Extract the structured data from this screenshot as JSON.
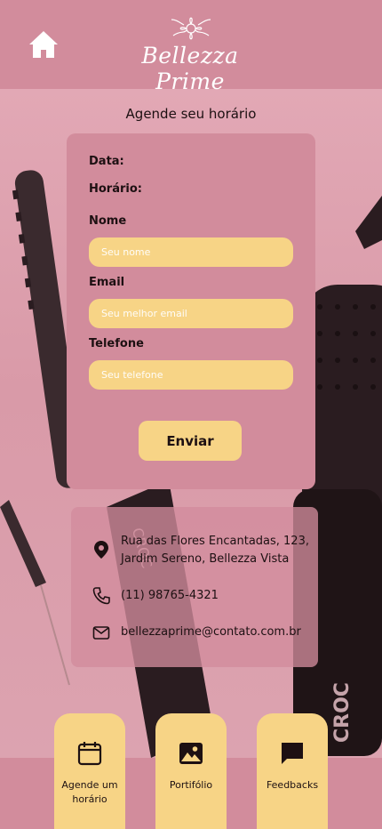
{
  "header": {
    "logo_text": "Bellezza Prime"
  },
  "page_title": "Agende seu horário",
  "form": {
    "date_label": "Data:",
    "time_label": "Horário:",
    "name_label": "Nome",
    "name_placeholder": "Seu nome",
    "email_label": "Email",
    "email_placeholder": "Seu melhor email",
    "phone_label": "Telefone",
    "phone_placeholder": "Seu telefone",
    "submit_label": "Enviar"
  },
  "contact": {
    "address_line1": "Rua das Flores Encantadas, 123,",
    "address_line2": "Jardim Sereno, Bellezza Vista",
    "phone": "(11) 98765-4321",
    "email": "bellezzaprime@contato.com.br"
  },
  "nav": [
    {
      "label_line1": "Agende um",
      "label_line2": "horário",
      "icon": "calendar-icon"
    },
    {
      "label_line1": "Portifólio",
      "label_line2": "",
      "icon": "image-icon"
    },
    {
      "label_line1": "Feedbacks",
      "label_line2": "",
      "icon": "chat-icon"
    }
  ],
  "colors": {
    "primary": "#d28c9c",
    "accent": "#f7d486",
    "text": "#1d1012"
  },
  "background_image_text": "CROC"
}
